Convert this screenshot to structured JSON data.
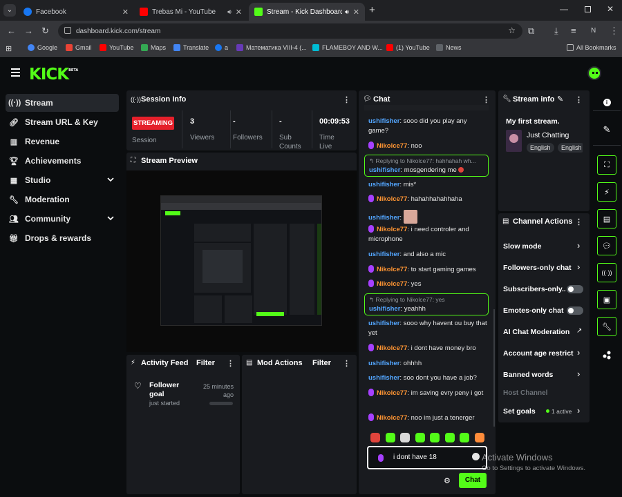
{
  "browser": {
    "tabs": [
      {
        "title": "Facebook",
        "color": "#1877f2"
      },
      {
        "title": "Trebas Mi - YouTube",
        "color": "#ff0000"
      },
      {
        "title": "Stream - Kick Dashboard",
        "color": "#53fc18"
      }
    ],
    "url": "dashboard.kick.com/stream",
    "bookmarks": [
      {
        "label": "Google",
        "color": "#4285f4"
      },
      {
        "label": "Gmail",
        "color": "#ea4335"
      },
      {
        "label": "YouTube",
        "color": "#ff0000"
      },
      {
        "label": "Maps",
        "color": "#34a853"
      },
      {
        "label": "Translate",
        "color": "#4285f4"
      },
      {
        "label": "a",
        "color": "#1877f2"
      },
      {
        "label": "Математика VIII-4 (...",
        "color": "#673ab7"
      },
      {
        "label": "FLAMEBOY AND W...",
        "color": "#00bcd4"
      },
      {
        "label": "(1) YouTube",
        "color": "#ff0000"
      },
      {
        "label": "News",
        "color": "#5f6368"
      }
    ],
    "all_bookmarks": "All Bookmarks",
    "profile_initial": "N"
  },
  "app": {
    "logo": "KICK",
    "logo_sup": "BETA"
  },
  "sidebar": {
    "items": [
      {
        "label": "Stream",
        "icon": "broadcast-icon"
      },
      {
        "label": "Stream URL & Key",
        "icon": "link-icon"
      },
      {
        "label": "Revenue",
        "icon": "chart-icon"
      },
      {
        "label": "Achievements",
        "icon": "trophy-icon"
      },
      {
        "label": "Studio",
        "icon": "film-icon"
      },
      {
        "label": "Moderation",
        "icon": "wrench-icon"
      },
      {
        "label": "Community",
        "icon": "users-icon"
      },
      {
        "label": "Drops & rewards",
        "icon": "gift-icon"
      }
    ]
  },
  "session": {
    "title": "Session Info",
    "badge": "STREAMING",
    "badge_label": "Session",
    "stats": [
      {
        "value": "3",
        "label": "Viewers"
      },
      {
        "value": "-",
        "label": "Followers"
      },
      {
        "value": "-",
        "label": "Sub Counts"
      },
      {
        "value": "00:09:53",
        "label": "Time Live"
      }
    ]
  },
  "preview": {
    "title": "Stream Preview"
  },
  "activity": {
    "title": "Activity Feed",
    "filter": "Filter",
    "item_title": "Follower goal",
    "item_sub": "just started",
    "item_time": "25 minutes ago"
  },
  "mod": {
    "title": "Mod Actions",
    "filter": "Filter"
  },
  "chat": {
    "title": "Chat",
    "messages": [
      {
        "user": "ushifisher",
        "text": "sooo did you play any game?"
      },
      {
        "user": "Nikolce77",
        "text": "noo"
      },
      {
        "reply_to": "Replying to Nikolce77: hahhahah wh...",
        "user": "ushifisher",
        "text": "mosgendering me"
      },
      {
        "user": "ushifisher",
        "text": "mis*"
      },
      {
        "user": "Nikolce77",
        "text": "hahahhahahhaha"
      },
      {
        "user": "ushifisher",
        "text": ""
      },
      {
        "user": "Nikolce77",
        "text": "i need controler and microphone"
      },
      {
        "user": "ushifisher",
        "text": "and also a mic"
      },
      {
        "user": "Nikolce77",
        "text": "to start gaming games"
      },
      {
        "user": "Nikolce77",
        "text": "yes"
      },
      {
        "reply_to": "Replying to Nikolce77: yes",
        "user": "ushifisher",
        "text": "yeahhh"
      },
      {
        "user": "ushifisher",
        "text": "sooo why havent ou buy that yet"
      },
      {
        "user": "Nikolce77",
        "text": "i dont have money bro"
      },
      {
        "user": "ushifisher",
        "text": "ohhhh"
      },
      {
        "user": "ushifisher",
        "text": "soo dont you have a job?"
      },
      {
        "user": "Nikolce77",
        "text": "im saving evry peny i got"
      },
      {
        "user": "Nikolce77",
        "text": "noo im just a tenerger"
      }
    ],
    "input_value": "i dont have 18",
    "send_label": "Chat",
    "emote_colors": [
      "#e0443c",
      "#53fc18",
      "#d9d9d9",
      "#53fc18",
      "#53fc18",
      "#53fc18",
      "#53fc18",
      "#ff8c3a"
    ]
  },
  "stream_info": {
    "title": "Stream info",
    "stream_title": "My first stream.",
    "category": "Just Chatting",
    "tags": [
      "English",
      "English"
    ]
  },
  "channel_actions": {
    "title": "Channel Actions",
    "items": [
      {
        "label": "Slow mode",
        "control": "chevron"
      },
      {
        "label": "Followers-only chat",
        "control": "chevron"
      },
      {
        "label": "Subscribers-only...",
        "control": "toggle"
      },
      {
        "label": "Emotes-only chat",
        "control": "toggle"
      },
      {
        "label": "AI Chat Moderation",
        "control": "external"
      },
      {
        "label": "Account age restricti...",
        "control": "chevron"
      },
      {
        "label": "Banned words",
        "control": "chevron"
      }
    ],
    "host_channel": "Host Channel",
    "set_goals": "Set goals",
    "active_badge": "1 active"
  },
  "overlay": {
    "activate_title": "Activate Windows",
    "activate_sub": "Go to Settings to activate Windows."
  }
}
